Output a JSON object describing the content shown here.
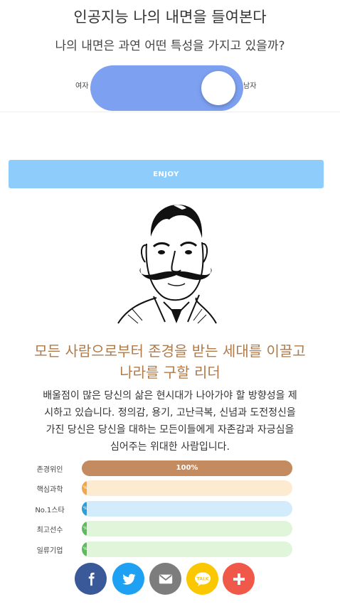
{
  "header": {
    "title": "인공지능 나의 내면을 들여본다",
    "subtitle": "나의 내면은 과연 어떤 특성을 가지고 있을까?"
  },
  "gender_toggle": {
    "left_label": "여자",
    "right_label": "남자",
    "color": "#7da0f1",
    "selected": "남자"
  },
  "enjoy_button": {
    "label": "ENJOY",
    "color": "#8ecdfb"
  },
  "result": {
    "title_line1": "모든 사람으로부터 존경을 받는 세대를 이끌고",
    "title_line2": "나라를 구할 리더",
    "description_line1": "배울점이 많은 당신의 삶은 현시대가 나아가야 할 방향성을 제",
    "description_line2": "시하고 있습니다. 정의감, 용기, 고난극복, 신념과 도전정신을",
    "description_line3": "가진 당신은 당신을 대하는 모든이들에게 자존감과 자긍심을",
    "description_line4": "심어주는 위대한 사람입니다."
  },
  "stats": [
    {
      "label": "존경위인",
      "percent": 100,
      "percent_text": "100%",
      "fill": "#c48a60",
      "track": "#c48a60"
    },
    {
      "label": "핵심과학",
      "percent": 2,
      "percent_text": "%",
      "fill": "#f0a64a",
      "track": "#fdebd1"
    },
    {
      "label": "No.1스타",
      "percent": 2,
      "percent_text": "%",
      "fill": "#2a9ed8",
      "track": "#d2ecfb"
    },
    {
      "label": "최고선수",
      "percent": 2,
      "percent_text": "%",
      "fill": "#5cbb5c",
      "track": "#e0f5da"
    },
    {
      "label": "일류기업",
      "percent": 2,
      "percent_text": "%",
      "fill": "#5cbb5c",
      "track": "#e0f5da"
    }
  ],
  "share": {
    "facebook": {
      "icon": "facebook-icon",
      "color": "#3a5998"
    },
    "twitter": {
      "icon": "twitter-icon",
      "color": "#1ea1f2"
    },
    "email": {
      "icon": "mail-icon",
      "color": "#7d7d7d"
    },
    "kakao": {
      "icon": "kakao-talk-icon",
      "color": "#fbc700",
      "label": "TALK"
    },
    "more": {
      "icon": "plus-icon",
      "color": "#f0584a"
    }
  }
}
